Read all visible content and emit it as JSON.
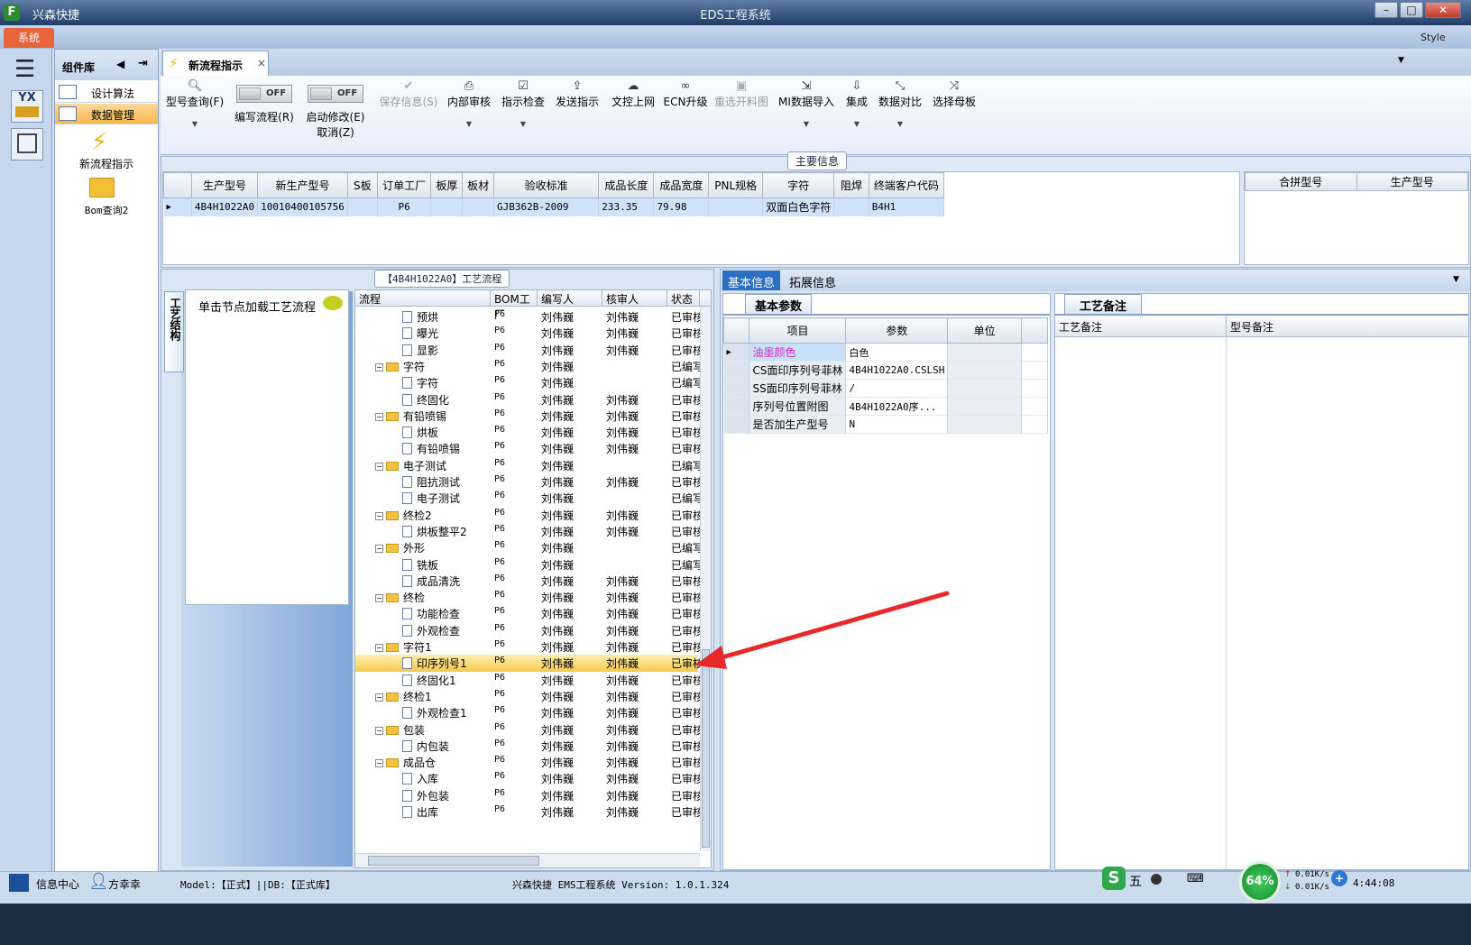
{
  "app": {
    "logo": "F",
    "name": "兴森快捷",
    "window_title": "EDS工程系统",
    "min": "–",
    "max": "□",
    "close": "✕"
  },
  "menubar": {
    "system": "系统",
    "style": "Style"
  },
  "left_icons": {
    "app1": "YX"
  },
  "component_library": {
    "title": "组件库",
    "items": [
      {
        "label": "设计算法"
      },
      {
        "label": "数据管理"
      }
    ],
    "tiles": [
      {
        "label": "新流程指示",
        "icon": "lightning-icon"
      },
      {
        "label": "Bom查询2",
        "icon": "folder-open-icon"
      }
    ]
  },
  "tabs": [
    {
      "label": "新流程指示",
      "close": "×"
    }
  ],
  "toolbar": {
    "items": [
      {
        "label": "型号查询(F)",
        "icon": "search-icon"
      },
      {
        "label": "编写流程(R)",
        "toggle": "OFF"
      },
      {
        "label": "启动修改(E)",
        "sub": "取消(Z)",
        "toggle": "OFF"
      },
      {
        "label": "保存信息(S)",
        "icon": "check-icon",
        "disabled": true
      },
      {
        "label": "内部审核",
        "icon": "printer-icon"
      },
      {
        "label": "指示检查",
        "icon": "checkbox-icon"
      },
      {
        "label": "发送指示",
        "icon": "upload-icon"
      },
      {
        "label": "文控上网",
        "icon": "cloud-upload-icon"
      },
      {
        "label": "ECN升级",
        "icon": "binoculars-icon"
      },
      {
        "label": "重选开料图",
        "icon": "image-icon",
        "disabled": true
      },
      {
        "label": "MI数据导入",
        "icon": "import-icon"
      },
      {
        "label": "集成",
        "icon": "download-icon"
      },
      {
        "label": "数据对比",
        "icon": "compress-icon"
      },
      {
        "label": "选择母板",
        "icon": "shuffle-icon"
      }
    ]
  },
  "main_info": {
    "tag": "主要信息",
    "columns": [
      "生产型号",
      "新生产型号",
      "S板",
      "订单工厂",
      "板厚",
      "板材",
      "验收标准",
      "成品长度",
      "成品宽度",
      "PNL规格",
      "字符",
      "阻焊",
      "终端客户代码"
    ],
    "row": [
      "4B4H1022A0",
      "10010400105756",
      "",
      "P6",
      "",
      "",
      "GJB362B-2009",
      "233.35",
      "79.98",
      "",
      "双面白色字符",
      "",
      "B4H1"
    ],
    "merge_columns": [
      "合拼型号",
      "生产型号"
    ]
  },
  "process": {
    "tag": "【4B4H1022A0】工艺流程",
    "vtab": "工艺结构",
    "hint": "单击节点加载工艺流程",
    "columns": [
      "流程",
      "BOM工厂",
      "编写人",
      "核审人",
      "状态"
    ],
    "rows": [
      {
        "name": "预烘",
        "lvl": 2,
        "f": "P6",
        "w": "刘伟巍",
        "r": "刘伟巍",
        "s": "已审核"
      },
      {
        "name": "曝光",
        "lvl": 2,
        "f": "P6",
        "w": "刘伟巍",
        "r": "刘伟巍",
        "s": "已审核"
      },
      {
        "name": "显影",
        "lvl": 2,
        "f": "P6",
        "w": "刘伟巍",
        "r": "刘伟巍",
        "s": "已审核"
      },
      {
        "name": "字符",
        "lvl": 1,
        "f": "P6",
        "w": "刘伟巍",
        "r": "",
        "s": "已编写"
      },
      {
        "name": "字符",
        "lvl": 2,
        "f": "P6",
        "w": "刘伟巍",
        "r": "",
        "s": "已编写"
      },
      {
        "name": "终固化",
        "lvl": 2,
        "f": "P6",
        "w": "刘伟巍",
        "r": "刘伟巍",
        "s": "已审核"
      },
      {
        "name": "有铅喷锡",
        "lvl": 1,
        "f": "P6",
        "w": "刘伟巍",
        "r": "刘伟巍",
        "s": "已审核"
      },
      {
        "name": "烘板",
        "lvl": 2,
        "f": "P6",
        "w": "刘伟巍",
        "r": "刘伟巍",
        "s": "已审核"
      },
      {
        "name": "有铅喷锡",
        "lvl": 2,
        "f": "P6",
        "w": "刘伟巍",
        "r": "刘伟巍",
        "s": "已审核"
      },
      {
        "name": "电子测试",
        "lvl": 1,
        "f": "P6",
        "w": "刘伟巍",
        "r": "",
        "s": "已编写"
      },
      {
        "name": "阻抗测试",
        "lvl": 2,
        "f": "P6",
        "w": "刘伟巍",
        "r": "刘伟巍",
        "s": "已审核"
      },
      {
        "name": "电子测试",
        "lvl": 2,
        "f": "P6",
        "w": "刘伟巍",
        "r": "",
        "s": "已编写"
      },
      {
        "name": "终检2",
        "lvl": 1,
        "f": "P6",
        "w": "刘伟巍",
        "r": "刘伟巍",
        "s": "已审核"
      },
      {
        "name": "烘板整平2",
        "lvl": 2,
        "f": "P6",
        "w": "刘伟巍",
        "r": "刘伟巍",
        "s": "已审核"
      },
      {
        "name": "外形",
        "lvl": 1,
        "f": "P6",
        "w": "刘伟巍",
        "r": "",
        "s": "已编写"
      },
      {
        "name": "铣板",
        "lvl": 2,
        "f": "P6",
        "w": "刘伟巍",
        "r": "",
        "s": "已编写"
      },
      {
        "name": "成品清洗",
        "lvl": 2,
        "f": "P6",
        "w": "刘伟巍",
        "r": "刘伟巍",
        "s": "已审核"
      },
      {
        "name": "终检",
        "lvl": 1,
        "f": "P6",
        "w": "刘伟巍",
        "r": "刘伟巍",
        "s": "已审核"
      },
      {
        "name": "功能检查",
        "lvl": 2,
        "f": "P6",
        "w": "刘伟巍",
        "r": "刘伟巍",
        "s": "已审核"
      },
      {
        "name": "外观检查",
        "lvl": 2,
        "f": "P6",
        "w": "刘伟巍",
        "r": "刘伟巍",
        "s": "已审核"
      },
      {
        "name": "字符1",
        "lvl": 1,
        "f": "P6",
        "w": "刘伟巍",
        "r": "刘伟巍",
        "s": "已审核"
      },
      {
        "name": "印序列号1",
        "lvl": 2,
        "f": "P6",
        "w": "刘伟巍",
        "r": "刘伟巍",
        "s": "已审核",
        "selected": true
      },
      {
        "name": "终固化1",
        "lvl": 2,
        "f": "P6",
        "w": "刘伟巍",
        "r": "刘伟巍",
        "s": "已审核"
      },
      {
        "name": "终检1",
        "lvl": 1,
        "f": "P6",
        "w": "刘伟巍",
        "r": "刘伟巍",
        "s": "已审核"
      },
      {
        "name": "外观检查1",
        "lvl": 2,
        "f": "P6",
        "w": "刘伟巍",
        "r": "刘伟巍",
        "s": "已审核"
      },
      {
        "name": "包装",
        "lvl": 1,
        "f": "P6",
        "w": "刘伟巍",
        "r": "刘伟巍",
        "s": "已审核"
      },
      {
        "name": "内包装",
        "lvl": 2,
        "f": "P6",
        "w": "刘伟巍",
        "r": "刘伟巍",
        "s": "已审核"
      },
      {
        "name": "成品仓",
        "lvl": 1,
        "f": "P6",
        "w": "刘伟巍",
        "r": "刘伟巍",
        "s": "已审核"
      },
      {
        "name": "入库",
        "lvl": 2,
        "f": "P6",
        "w": "刘伟巍",
        "r": "刘伟巍",
        "s": "已审核"
      },
      {
        "name": "外包装",
        "lvl": 2,
        "f": "P6",
        "w": "刘伟巍",
        "r": "刘伟巍",
        "s": "已审核"
      },
      {
        "name": "出库",
        "lvl": 2,
        "f": "P6",
        "w": "刘伟巍",
        "r": "刘伟巍",
        "s": "已审核"
      }
    ]
  },
  "right": {
    "tabs": [
      "基本信息",
      "拓展信息"
    ],
    "params_tab": "基本参数",
    "params_columns": [
      "项目",
      "参数",
      "单位"
    ],
    "params_rows": [
      {
        "item": "油墨颜色",
        "value": "白色",
        "unit": "",
        "highlight": true
      },
      {
        "item": "CS面印序列号菲林",
        "value": "4B4H1022A0.CSLSH",
        "unit": ""
      },
      {
        "item": "SS面印序列号菲林",
        "value": "/",
        "unit": ""
      },
      {
        "item": "序列号位置附图",
        "value": "4B4H1022A0序...",
        "unit": ""
      },
      {
        "item": "是否加生产型号",
        "value": "N",
        "unit": ""
      }
    ],
    "notes_tab": "工艺备注",
    "notes_columns": [
      "工艺备注",
      "型号备注"
    ]
  },
  "status": {
    "info_center": "信息中心",
    "user": "方幸幸",
    "model": "Model:【正式】||DB:【正式库】",
    "version": "兴森快捷 EMS工程系统 Version: 1.0.1.324",
    "ime": "五",
    "percent": "64%",
    "up": "0.01K/s",
    "down": "0.01K/s",
    "time": "4:44:08"
  },
  "colors": {
    "arrow": "#e8282a",
    "selected": "#f6c94e",
    "highlight_text": "#d42fc4",
    "system_menu": "#e9643a"
  }
}
